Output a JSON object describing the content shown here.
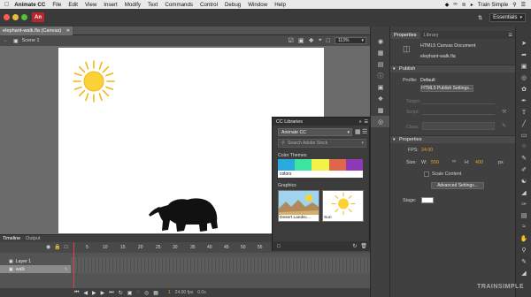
{
  "menubar": {
    "app_name": "Animate CC",
    "items": [
      "File",
      "Edit",
      "View",
      "Insert",
      "Modify",
      "Text",
      "Commands",
      "Control",
      "Debug",
      "Window",
      "Help"
    ],
    "right_label": "Train Simple"
  },
  "appbar": {
    "logo": "An",
    "workspace_label": "Essentials"
  },
  "document": {
    "tab_title": "elephant-walk.fla (Canvas)",
    "scene": "Scene 1",
    "zoom": "113%"
  },
  "cc_libraries": {
    "title": "CC Libraries",
    "library_name": "Animate CC",
    "search_placeholder": "Search Adobe Stock",
    "color_themes_label": "Color Themes",
    "theme_name": "colors",
    "theme_colors": [
      "#2aa9e0",
      "#3de3a1",
      "#f2f24a",
      "#e0664a",
      "#8e3ab8"
    ],
    "graphics_label": "Graphics",
    "graphics": [
      "Desert Landsc...",
      "Sun"
    ]
  },
  "timeline": {
    "tabs": [
      "Timeline",
      "Output"
    ],
    "frame_numbers": [
      "5",
      "10",
      "15",
      "20",
      "25",
      "30",
      "35",
      "40",
      "45",
      "50",
      "55",
      "6"
    ],
    "layers": [
      "Layer 1",
      "walk"
    ],
    "footer_frame": "1",
    "footer_fps": "24.00 fps",
    "footer_time": "0.0s"
  },
  "properties": {
    "tabs": [
      "Properties",
      "Library"
    ],
    "doc_type": "HTML5 Canvas Document",
    "doc_name": "elephant-walk.fla",
    "publish_section": "Publish",
    "profile_label": "Profile:",
    "profile_value": "Default",
    "publish_settings_button": "HTML5 Publish Settings...",
    "target_label": "Target:",
    "script_label": "Script:",
    "class_label": "Class:",
    "properties_section": "Properties",
    "fps_label": "FPS:",
    "fps_value": "24.00",
    "size_label": "Size:",
    "w_label": "W:",
    "w_value": "550",
    "h_label": "H:",
    "h_value": "400",
    "unit": "px",
    "scale_content": "Scale Content",
    "advanced_settings_button": "Advanced Settings...",
    "stage_label": "Stage:"
  },
  "watermark": "TRAINSIMPLE"
}
